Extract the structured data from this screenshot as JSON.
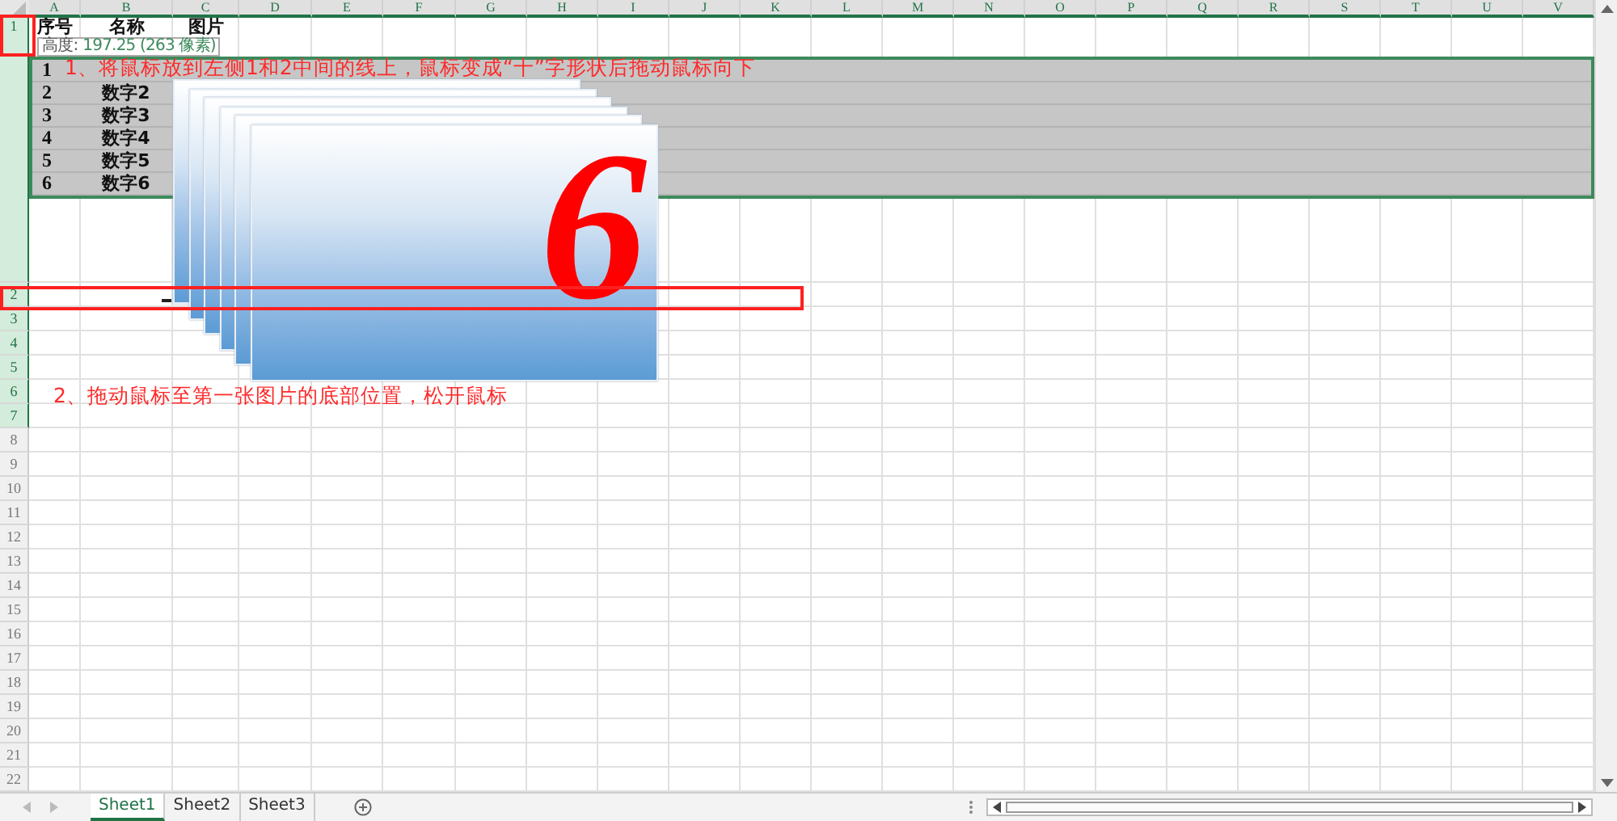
{
  "column_headers": [
    {
      "label": "A",
      "selected": true
    },
    {
      "label": "B",
      "selected": true
    },
    {
      "label": "C",
      "selected": true
    },
    {
      "label": "D",
      "selected": true
    },
    {
      "label": "E",
      "selected": true
    },
    {
      "label": "F",
      "selected": true
    },
    {
      "label": "G",
      "selected": true
    },
    {
      "label": "H",
      "selected": true
    },
    {
      "label": "I",
      "selected": true
    },
    {
      "label": "J",
      "selected": true
    },
    {
      "label": "K",
      "selected": true
    },
    {
      "label": "L",
      "selected": true
    },
    {
      "label": "M",
      "selected": true
    },
    {
      "label": "N",
      "selected": true
    },
    {
      "label": "O",
      "selected": true
    },
    {
      "label": "P",
      "selected": true
    },
    {
      "label": "Q",
      "selected": true
    },
    {
      "label": "R",
      "selected": true
    },
    {
      "label": "S",
      "selected": true
    },
    {
      "label": "T",
      "selected": true
    },
    {
      "label": "U",
      "selected": true
    },
    {
      "label": "V",
      "selected": true
    }
  ],
  "row_headers": [
    {
      "label": "1",
      "selected": true
    },
    {
      "label": "2",
      "selected": true
    },
    {
      "label": "3",
      "selected": true
    },
    {
      "label": "4",
      "selected": true
    },
    {
      "label": "5",
      "selected": true
    },
    {
      "label": "6",
      "selected": true
    },
    {
      "label": "7",
      "selected": true
    },
    {
      "label": "8",
      "selected": false
    },
    {
      "label": "9",
      "selected": false
    },
    {
      "label": "10",
      "selected": false
    },
    {
      "label": "11",
      "selected": false
    },
    {
      "label": "12",
      "selected": false
    },
    {
      "label": "13",
      "selected": false
    },
    {
      "label": "14",
      "selected": false
    },
    {
      "label": "15",
      "selected": false
    },
    {
      "label": "16",
      "selected": false
    },
    {
      "label": "17",
      "selected": false
    },
    {
      "label": "18",
      "selected": false
    },
    {
      "label": "19",
      "selected": false
    },
    {
      "label": "20",
      "selected": false
    },
    {
      "label": "21",
      "selected": false
    },
    {
      "label": "22",
      "selected": false
    }
  ],
  "header_cells": [
    "序号",
    "名称",
    "图片"
  ],
  "data_rows": [
    {
      "number": "1"
    },
    {
      "number": "2",
      "name": "数字2"
    },
    {
      "number": "3",
      "name": "数字3"
    },
    {
      "number": "4",
      "name": "数字4"
    },
    {
      "number": "5",
      "name": "数字5"
    },
    {
      "number": "6",
      "name": "数字6"
    }
  ],
  "images": [
    {
      "kind": "card"
    },
    {
      "kind": "card"
    },
    {
      "kind": "card"
    },
    {
      "kind": "card"
    },
    {
      "kind": "card"
    },
    {
      "kind": "numbered",
      "label": "6"
    }
  ],
  "tooltip": {
    "label": "高度:",
    "value": "197.25 (263 像素)"
  },
  "annotations": [
    "1、将鼠标放到左侧1和2中间的线上，鼠标变成“十”字形状后拖动鼠标向下",
    "2、拖动鼠标至第一张图片的底部位置，松开鼠标"
  ],
  "sheet_tabs": [
    {
      "label": "Sheet1",
      "selected": true
    },
    {
      "label": "Sheet2",
      "selected": false
    },
    {
      "label": "Sheet3",
      "selected": false
    }
  ]
}
